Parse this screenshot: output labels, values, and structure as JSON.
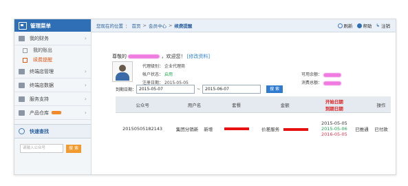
{
  "sidebar": {
    "title": "管理菜单",
    "menu": [
      {
        "label": "我的财务"
      },
      {
        "label": "终端店管理"
      },
      {
        "label": "终端店数据"
      },
      {
        "label": "服务支持"
      },
      {
        "label": "产品仓库"
      }
    ],
    "submenu": [
      {
        "label": "我的账出",
        "active": false
      },
      {
        "label": "续费提醒",
        "active": true
      }
    ],
    "quick_search": {
      "title": "快速查找",
      "placeholder": "请输入公众号",
      "button": "搜 索"
    }
  },
  "topbar": {
    "breadcrumb_prefix": "您现在的位置",
    "crumbs": [
      "首页",
      "会员中心",
      "续费提醒"
    ],
    "refresh": "刷新",
    "help": "帮助",
    "logout": "注销"
  },
  "profile": {
    "greeting_prefix": "尊敬的",
    "greeting_suffix": "，欢迎您！",
    "edit_link": "[修改资料]",
    "agent_level_label": "代理级别：",
    "agent_level": "企业代理商",
    "status_label": "帐户状态：",
    "status": "启用",
    "reg_date_label": "注册日期：",
    "reg_date": "2015-05-05",
    "available_label": "可用余额：",
    "consumed_label": "消费总额："
  },
  "filter": {
    "label": "到期日期：",
    "from": "2015-05-07",
    "to_sep": "~",
    "to": "2015-06-07",
    "button": "搜 索"
  },
  "table": {
    "headers": [
      "公众号",
      "用户名",
      "套餐",
      "金额",
      "开始日期",
      "到期日期",
      "操作"
    ],
    "row": {
      "account": "20150505182143",
      "username": "集团分销新",
      "package_extra": "新增",
      "pkg_name": "价差服务",
      "start_date": "2015-05-05",
      "mid_date": "2015-05-06",
      "end_date": "2016-05-05",
      "status": "已推通",
      "op": "已付款"
    }
  },
  "colors": {
    "accent": "#2f6fb6",
    "warning": "#e02020"
  }
}
